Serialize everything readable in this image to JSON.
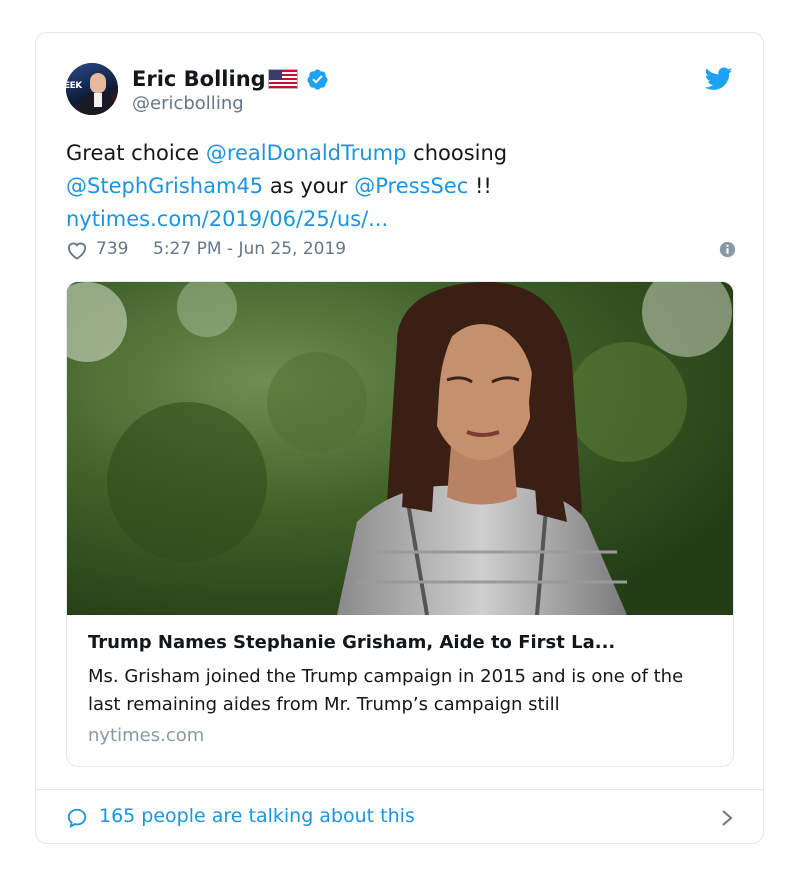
{
  "user": {
    "name": "Eric Bolling",
    "handle": "@ericbolling",
    "avatar_text": "EEK"
  },
  "tweet": {
    "line1_prefix": "Great choice ",
    "mention1": "@realDonaldTrump",
    "line1_suffix": " choosing",
    "mention2": "@StephGrisham45",
    "line2_mid": " as your ",
    "mention3": "@PressSec",
    "line2_suffix": " !!",
    "link": "nytimes.com/2019/06/25/us/..."
  },
  "meta": {
    "likes": "739",
    "timestamp": "5:27 PM - Jun 25, 2019"
  },
  "link_card": {
    "title": "Trump Names Stephanie Grisham, Aide to First La...",
    "description": "Ms. Grisham joined the Trump campaign in 2015 and is one of the last remaining aides from Mr. Trump’s campaign still",
    "domain": "nytimes.com"
  },
  "footer": {
    "talking": "165 people are talking about this"
  },
  "colors": {
    "accent": "#1b95e0",
    "text": "#14171a",
    "muted": "#657786",
    "border": "#e1e8ed"
  },
  "icons": [
    "verified-icon",
    "twitter-bird-icon",
    "heart-icon",
    "info-icon",
    "speech-bubble-icon",
    "chevron-right-icon"
  ]
}
